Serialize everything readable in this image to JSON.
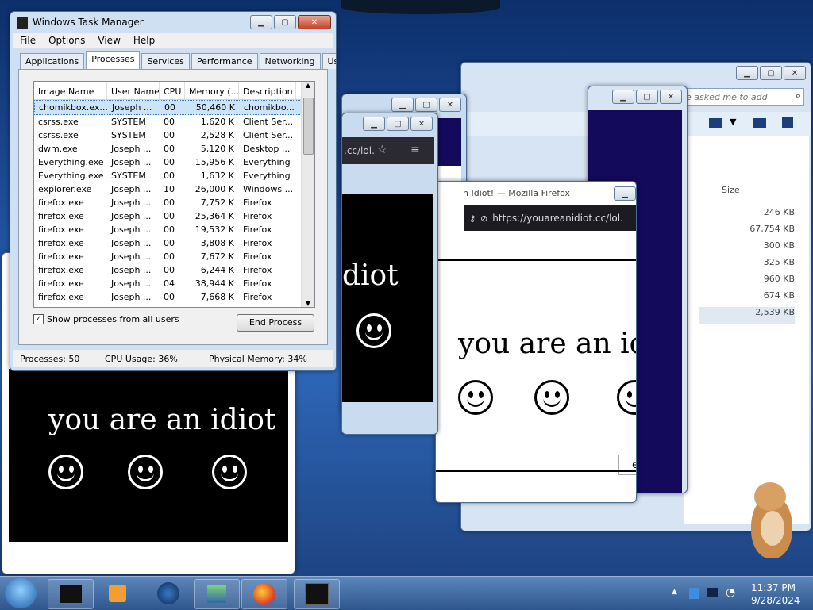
{
  "task_manager": {
    "title": "Windows Task Manager",
    "menu": [
      "File",
      "Options",
      "View",
      "Help"
    ],
    "tabs": [
      "Applications",
      "Processes",
      "Services",
      "Performance",
      "Networking",
      "Users"
    ],
    "active_tab": "Processes",
    "columns": [
      "Image Name",
      "User Name",
      "CPU",
      "Memory (...",
      "Description"
    ],
    "rows": [
      [
        "chomikbox.ex...",
        "Joseph ...",
        "00",
        "50,460 K",
        "chomikbo..."
      ],
      [
        "csrss.exe",
        "SYSTEM",
        "00",
        "1,620 K",
        "Client Ser..."
      ],
      [
        "csrss.exe",
        "SYSTEM",
        "00",
        "2,528 K",
        "Client Ser..."
      ],
      [
        "dwm.exe",
        "Joseph ...",
        "00",
        "5,120 K",
        "Desktop ..."
      ],
      [
        "Everything.exe",
        "Joseph ...",
        "00",
        "15,956 K",
        "Everything"
      ],
      [
        "Everything.exe",
        "SYSTEM",
        "00",
        "1,632 K",
        "Everything"
      ],
      [
        "explorer.exe",
        "Joseph ...",
        "10",
        "26,000 K",
        "Windows ..."
      ],
      [
        "firefox.exe",
        "Joseph ...",
        "00",
        "7,752 K",
        "Firefox"
      ],
      [
        "firefox.exe",
        "Joseph ...",
        "00",
        "25,364 K",
        "Firefox"
      ],
      [
        "firefox.exe",
        "Joseph ...",
        "00",
        "19,532 K",
        "Firefox"
      ],
      [
        "firefox.exe",
        "Joseph ...",
        "00",
        "3,808 K",
        "Firefox"
      ],
      [
        "firefox.exe",
        "Joseph ...",
        "00",
        "7,672 K",
        "Firefox"
      ],
      [
        "firefox.exe",
        "Joseph ...",
        "00",
        "6,244 K",
        "Firefox"
      ],
      [
        "firefox.exe",
        "Joseph ...",
        "04",
        "38,944 K",
        "Firefox"
      ],
      [
        "firefox.exe",
        "Joseph ...",
        "00",
        "7,668 K",
        "Firefox"
      ]
    ],
    "show_all_label": "Show processes from all users",
    "end_process_label": "End Process",
    "status": {
      "processes": "Processes: 50",
      "cpu": "CPU Usage: 36%",
      "memory": "Physical Memory: 34%"
    }
  },
  "explorer": {
    "search_placeholder": "ple asked me to add",
    "size_header": "Size",
    "sizes": [
      "246 KB",
      "67,754 KB",
      "300 KB",
      "325 KB",
      "960 KB",
      "674 KB",
      "2,539 KB"
    ]
  },
  "idiot": {
    "text_full": "you are an idiot",
    "text_partial": "diot",
    "text_cut": "you are an idio",
    "ff_title": "n Idiot! — Mozilla Firefox",
    "url": "https://youareanidiot.cc/lol.",
    "url_short": ".cc/lol.",
    "next_label": "ext"
  },
  "tray": {
    "time": "11:37 PM",
    "date": "9/28/2024"
  },
  "colors": {
    "navy": "#130a5c",
    "black": "#000000",
    "taskbar": "#2d568e"
  }
}
